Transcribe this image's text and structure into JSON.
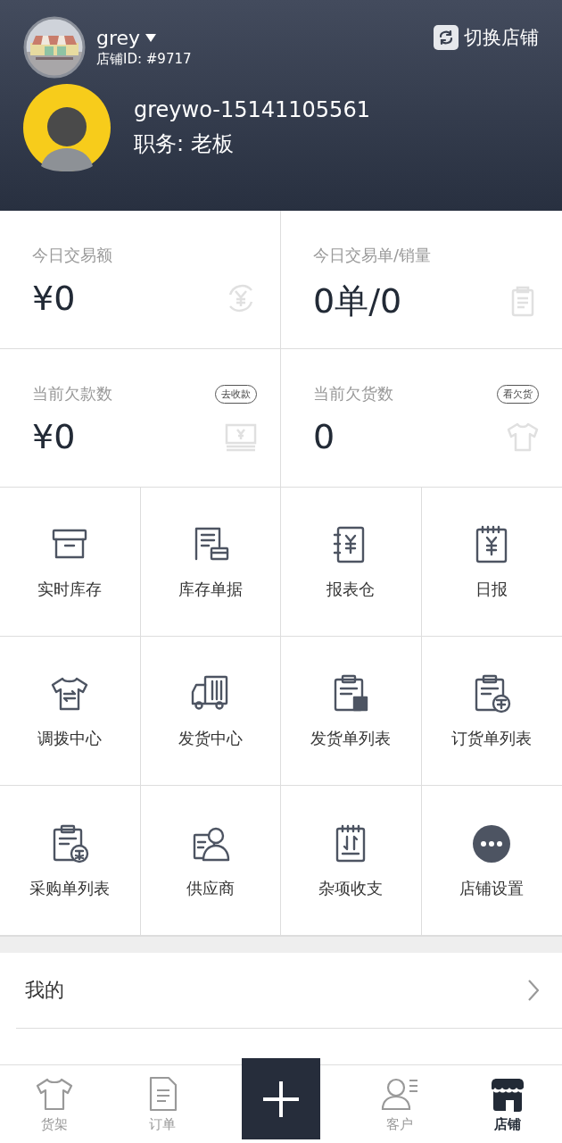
{
  "header": {
    "store_name": "grey",
    "store_id": "店铺ID: #9717",
    "switch_label": "切换店铺",
    "username": "greywo-15141105561",
    "role": "职务: 老板"
  },
  "stats": [
    {
      "label": "今日交易额",
      "value": "¥0",
      "kind": "money"
    },
    {
      "label": "今日交易单/销量",
      "value": "0单/0",
      "kind": "clipboard"
    },
    {
      "label": "当前欠款数",
      "value": "¥0",
      "action": "去收款",
      "kind": "cash"
    },
    {
      "label": "当前欠货数",
      "value": "0",
      "action": "看欠货",
      "kind": "shirt"
    }
  ],
  "shortcuts": [
    {
      "label": "实时库存",
      "kind": "box"
    },
    {
      "label": "库存单据",
      "kind": "docbox"
    },
    {
      "label": "报表仓",
      "kind": "ledger"
    },
    {
      "label": "日报",
      "kind": "daily"
    },
    {
      "label": "调拨中心",
      "kind": "transfer"
    },
    {
      "label": "发货中心",
      "kind": "truck"
    },
    {
      "label": "发货单列表",
      "kind": "shiplist"
    },
    {
      "label": "订货单列表",
      "kind": "orderlist"
    },
    {
      "label": "采购单列表",
      "kind": "purchase"
    },
    {
      "label": "供应商",
      "kind": "supplier"
    },
    {
      "label": "杂项收支",
      "kind": "misc"
    },
    {
      "label": "店铺设置",
      "kind": "more"
    }
  ],
  "menu": [
    {
      "label": "我的"
    }
  ],
  "tabs": [
    {
      "label": "货架",
      "kind": "shirt",
      "selected": false
    },
    {
      "label": "订单",
      "kind": "doc",
      "selected": false
    },
    {
      "kind": "plus"
    },
    {
      "label": "客户",
      "kind": "customer",
      "selected": false
    },
    {
      "label": "店铺",
      "kind": "store",
      "selected": true
    }
  ]
}
